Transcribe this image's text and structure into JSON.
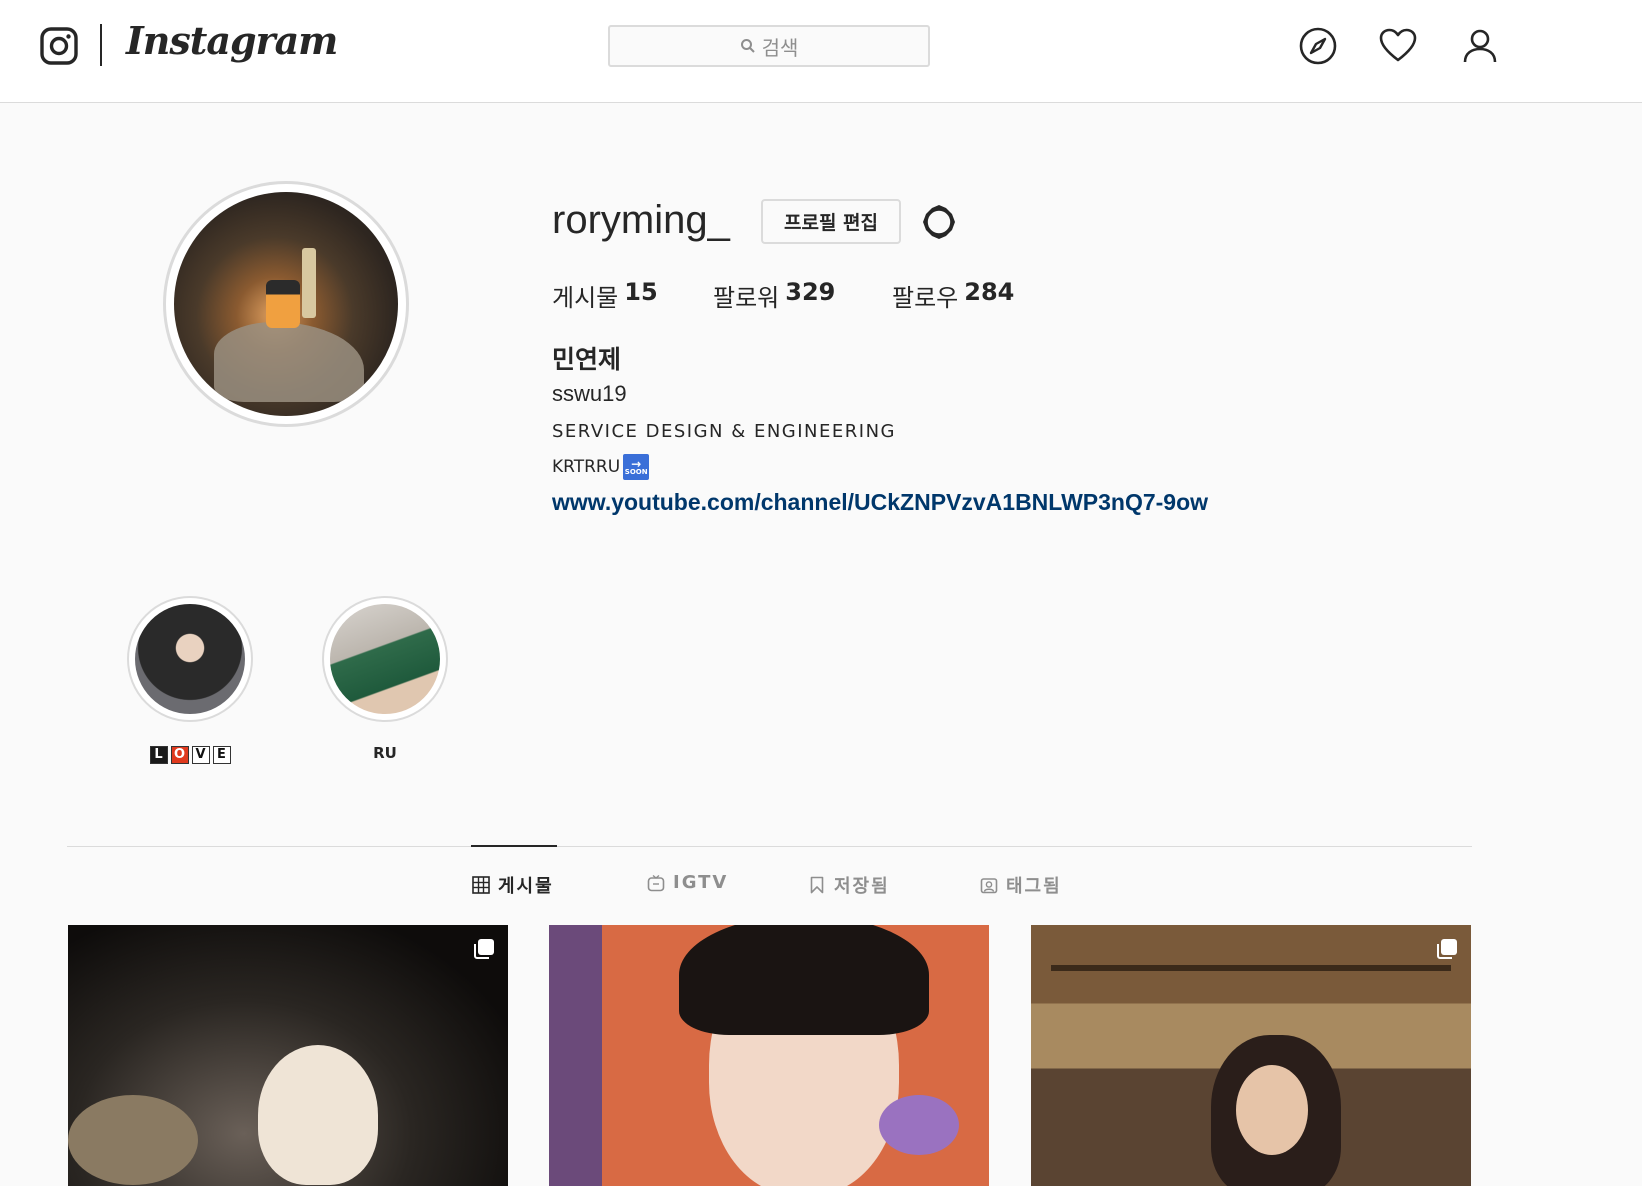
{
  "header": {
    "brand": "Instagram",
    "search_placeholder": "검색",
    "nav_icons": [
      "explore-icon",
      "heart-icon",
      "profile-icon"
    ]
  },
  "profile": {
    "username": "roryming_",
    "edit_button": "프로필 편집",
    "stats": {
      "posts_label": "게시물",
      "posts_count": "15",
      "followers_label": "팔로워",
      "followers_count": "329",
      "following_label": "팔로우",
      "following_count": "284"
    },
    "full_name": "민연제",
    "bio_line1": "sswu19",
    "bio_line2": "SERVICE DESIGN & ENGINEERING",
    "bio_line3": "KRTRRU",
    "bio_badge": "SOON",
    "link": "www.youtube.com/channel/UCkZNPVzvA1BNLWP3nQ7-9ow"
  },
  "highlights": [
    {
      "label": "LOVE",
      "letters": [
        "L",
        "O",
        "V",
        "E"
      ]
    },
    {
      "label": "RU"
    }
  ],
  "tabs": [
    {
      "label": "게시물",
      "icon": "grid-icon",
      "active": true
    },
    {
      "label": "IGTV",
      "icon": "igtv-icon",
      "active": false
    },
    {
      "label": "저장됨",
      "icon": "bookmark-icon",
      "active": false
    },
    {
      "label": "태그됨",
      "icon": "tag-person-icon",
      "active": false
    }
  ],
  "colors": {
    "link": "#00376b",
    "border": "#dbdbdb",
    "text": "#262626",
    "muted": "#8e8e8e"
  }
}
